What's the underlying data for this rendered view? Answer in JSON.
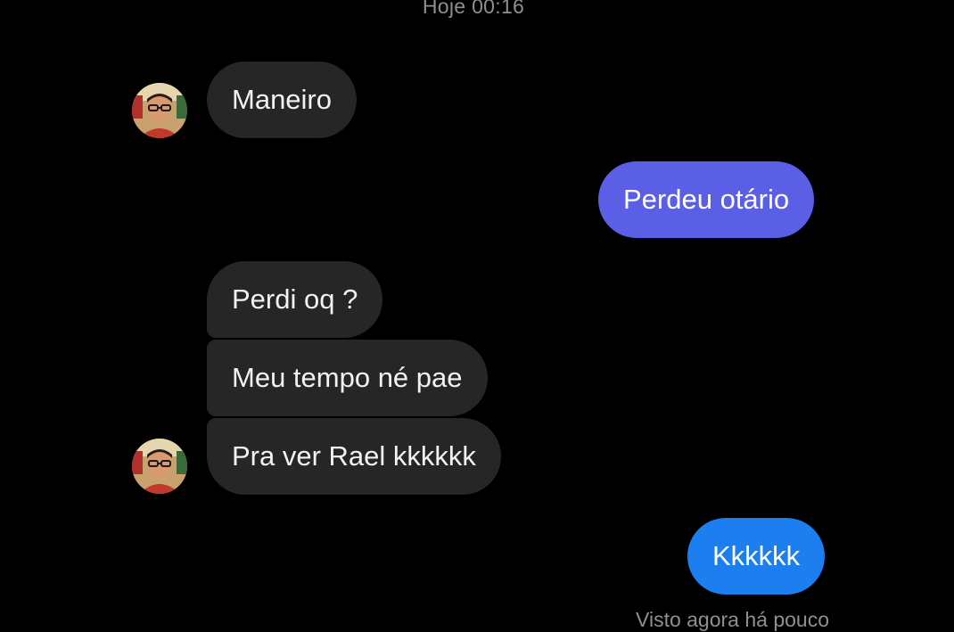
{
  "conversation": {
    "timestamp": "Hoje 00:16",
    "messages": [
      {
        "id": "m1",
        "direction": "incoming",
        "text": "Maneiro"
      },
      {
        "id": "m2",
        "direction": "outgoing",
        "text": "Perdeu otário"
      },
      {
        "id": "m3",
        "direction": "incoming",
        "text": "Perdi oq ?"
      },
      {
        "id": "m4",
        "direction": "incoming",
        "text": "Meu tempo né pae"
      },
      {
        "id": "m5",
        "direction": "incoming",
        "text": "Pra ver Rael kkkkkk"
      },
      {
        "id": "m6",
        "direction": "outgoing",
        "text": "Kkkkkk"
      }
    ],
    "seen_status": "Visto agora há pouco"
  },
  "colors": {
    "background": "#000000",
    "incoming_bubble": "#262626",
    "outgoing_bubble_purple": "#5b5fe6",
    "outgoing_bubble_blue": "#1d7ef0",
    "meta_text": "#8e8e93"
  },
  "icons": {
    "contact_avatar": "profile-photo-person-with-glasses"
  }
}
